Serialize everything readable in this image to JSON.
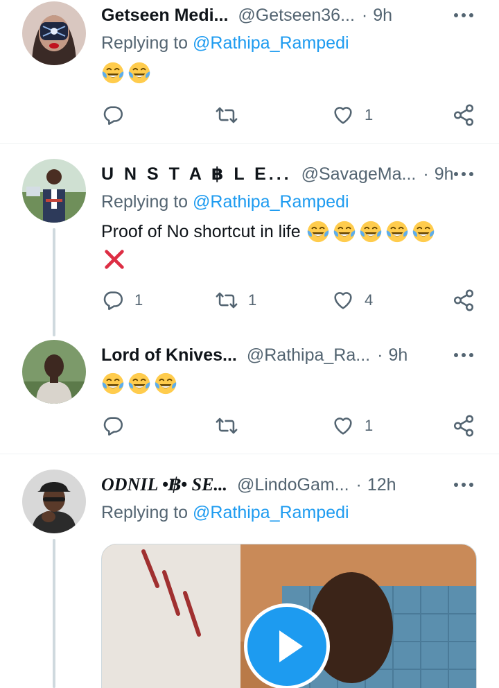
{
  "tweets": [
    {
      "name": "Getseen Medi...",
      "handle": "@Getseen36...",
      "dot": "·",
      "time": "9h",
      "reply_prefix": "Replying to",
      "reply_to": "@Rathipa_Rampedi",
      "text": "",
      "emojis": [
        "face-with-tears-of-joy",
        "face-with-tears-of-joy"
      ],
      "counts": {
        "replies": "",
        "retweets": "",
        "likes": "1"
      }
    },
    {
      "name": "U N S T A ฿ L E...",
      "handle": "@SavageMa...",
      "dot": "·",
      "time": "9h",
      "reply_prefix": "Replying to",
      "reply_to": "@Rathipa_Rampedi",
      "text": "Proof of No shortcut in life",
      "emojis": [
        "face-with-tears-of-joy",
        "face-with-tears-of-joy",
        "face-with-tears-of-joy",
        "face-with-tears-of-joy",
        "face-with-tears-of-joy",
        "cross-mark"
      ],
      "counts": {
        "replies": "1",
        "retweets": "1",
        "likes": "4"
      }
    },
    {
      "name": "Lord of Knives...",
      "handle": "@Rathipa_Ra...",
      "dot": "·",
      "time": "9h",
      "reply_prefix": "",
      "reply_to": "",
      "text": "",
      "emojis": [
        "face-with-tears-of-joy",
        "face-with-tears-of-joy",
        "face-with-tears-of-joy"
      ],
      "counts": {
        "replies": "",
        "retweets": "",
        "likes": "1"
      }
    },
    {
      "name": "ODNIL •฿• SE...",
      "handle": "@LindoGam...",
      "dot": "·",
      "time": "12h",
      "reply_prefix": "Replying to",
      "reply_to": "@Rathipa_Rampedi",
      "media": "video",
      "media_icon": "play-icon"
    }
  ],
  "colors": {
    "accent": "#1d9bf0",
    "secondary_text": "#536471",
    "primary_text": "#0f1419",
    "divider": "#eff3f4",
    "thread_line": "#cfd9de",
    "emoji_yellow": "#ffcc4d",
    "emoji_tear": "#5dadec",
    "cross_red": "#dd2e44"
  },
  "icons": [
    "reply-icon",
    "retweet-icon",
    "like-icon",
    "share-icon",
    "more-icon"
  ]
}
